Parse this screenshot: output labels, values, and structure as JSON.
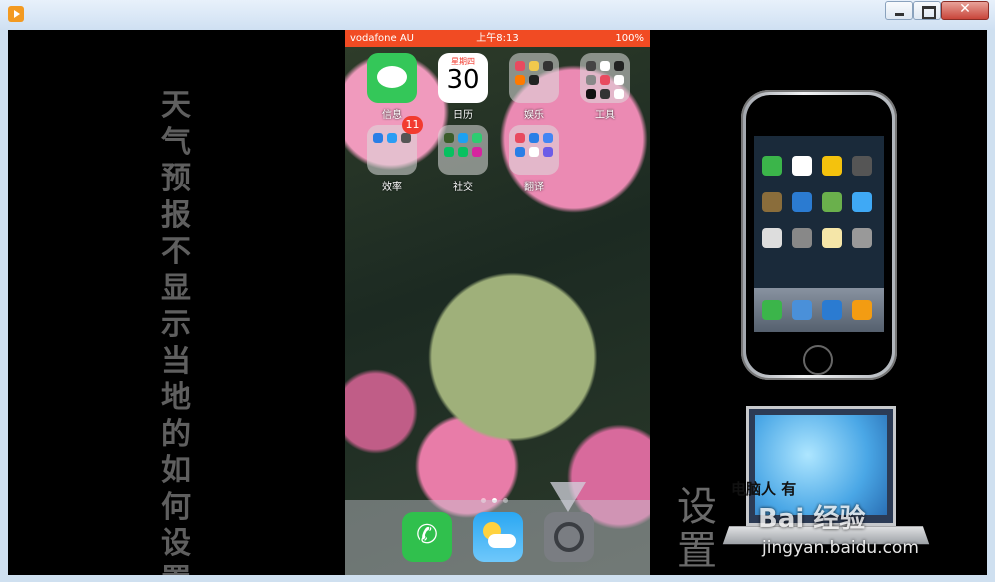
{
  "left_title_chars": [
    "天",
    "气",
    "预",
    "报",
    "不",
    "显",
    "示",
    "当",
    "地",
    "的",
    "如",
    "何",
    "设",
    "置"
  ],
  "right_label_chars": [
    "设",
    "置"
  ],
  "phone": {
    "carrier": "vodafone AU",
    "time": "上午8:13",
    "battery": "100%",
    "calendar_weekday": "星期四",
    "calendar_day": "30",
    "apps": [
      {
        "label": "信息"
      },
      {
        "label": "日历"
      },
      {
        "label": "娱乐"
      },
      {
        "label": "工具"
      },
      {
        "label": "效率"
      },
      {
        "label": "社交"
      },
      {
        "label": "翻译"
      }
    ],
    "badge": "11",
    "dock": [
      "phone",
      "weather",
      "settings"
    ]
  },
  "laptop_text": "电脑人 有",
  "watermark": "Bai 经验",
  "watermark_url": "jingyan.baidu.com",
  "colors": {
    "status_bar": "#f14b23",
    "messages": "#34c759",
    "phone": "#30c04d",
    "weather": "#2aa7f2"
  }
}
